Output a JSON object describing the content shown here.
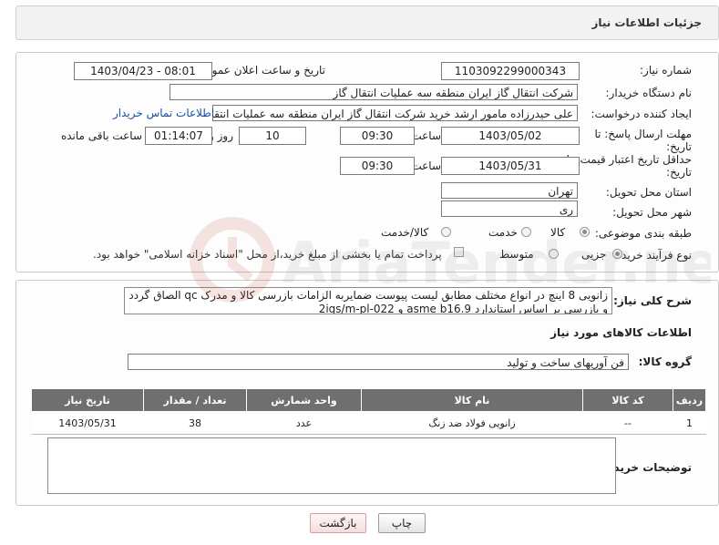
{
  "header": {
    "title": "جزئیات اطلاعات نیاز"
  },
  "form": {
    "need_number": {
      "label": "شماره نیاز:",
      "value": "1103092299000343"
    },
    "announce_datetime": {
      "label": "تاریخ و ساعت اعلان عمومی:",
      "value": "1403/04/23 - 08:01"
    },
    "buyer_org": {
      "label": "نام دستگاه خریدار:",
      "value": "شرکت انتقال گاز ایران منطقه سه عملیات انتقال گاز"
    },
    "requester": {
      "label": "ایجاد کننده درخواست:",
      "value": "علی حیدرزاده مامور ارشد خرید شرکت انتقال گاز ایران منطقه سه عملیات انتقال",
      "contact_link": "اطلاعات تماس خریدار"
    },
    "reply_deadline": {
      "label": "مهلت ارسال پاسخ: تا تاریخ:",
      "date": "1403/05/02",
      "time_label": "ساعت",
      "time": "09:30",
      "days": "10",
      "days_label": "روز و",
      "remaining": "01:14:07",
      "remaining_label": "ساعت باقی مانده"
    },
    "price_validity": {
      "label": "حداقل تاریخ اعتبار قیمت: تا تاریخ:",
      "date": "1403/05/31",
      "time_label": "ساعت",
      "time": "09:30"
    },
    "province": {
      "label": "استان محل تحویل:",
      "value": "تهران"
    },
    "city": {
      "label": "شهر محل تحویل:",
      "value": "ری"
    },
    "category": {
      "label": "طبقه بندی موضوعی:",
      "options": [
        "کالا",
        "خدمت",
        "کالا/خدمت"
      ]
    },
    "process": {
      "label": "نوع فرآیند خرید :",
      "options": [
        "جزیی",
        "متوسط"
      ],
      "payment_note": "پرداخت تمام یا بخشی از مبلغ خرید،از محل \"اسناد خزانه اسلامی\" خواهد بود."
    }
  },
  "description": {
    "label": "شرح کلی نیاز:",
    "text": "زانویی 8 اینچ در انواع مختلف مطابق لیست پیوست ضمایربه الزامات بازرسی کالا و مدرک qc الصاق گردد و بازرسی بر اساس استاندارد asme b16.9 و 2igs/m-pl-022"
  },
  "goods_section": {
    "title": "اطلاعات کالاهای مورد نیاز",
    "group_label": "گروه کالا:",
    "group_value": "فن آوریهای ساخت و تولید"
  },
  "table": {
    "columns": [
      "ردیف",
      "کد کالا",
      "نام کالا",
      "واحد شمارش",
      "تعداد / مقدار",
      "تاریخ نیاز"
    ],
    "rows": [
      [
        "1",
        "--",
        "زانویی فولاد ضد زنگ",
        "عدد",
        "38",
        "1403/05/31"
      ]
    ]
  },
  "buyer_notes": {
    "label": "توضیحات خریدار:",
    "value": ""
  },
  "buttons": {
    "print": "چاپ",
    "back": "بازگشت"
  },
  "watermark": "AriaTender.neT"
}
